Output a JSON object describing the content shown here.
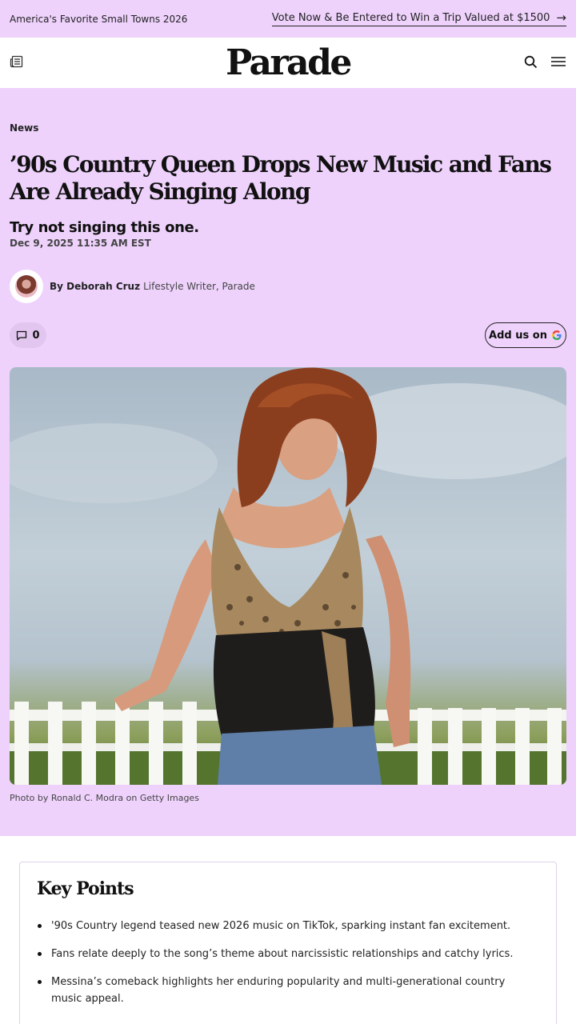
{
  "promo": {
    "left_text": "America's Favorite Small Towns 2026",
    "link_text": "Vote Now & Be Entered to Win a Trip Valued at $1500",
    "arrow": "→"
  },
  "nav": {
    "logo": "Parade",
    "icons": {
      "left": "newspaper-icon",
      "search": "search-icon",
      "menu": "hamburger-menu-icon"
    }
  },
  "article": {
    "category": "News",
    "headline": "’90s Country Queen Drops New Music and Fans Are Already Singing Along",
    "subheadline": "Try not singing this one.",
    "date": "Dec 9, 2025 11:35 AM EST",
    "author": {
      "byline": "By Deborah Cruz",
      "role": "Lifestyle Writer, Parade"
    },
    "comments_count": "0",
    "google_button_label": "Add us on",
    "google_glyph": "G",
    "photo_credit": "Photo by Ronald C. Modra on Getty Images"
  },
  "key_points": {
    "title": "Key Points",
    "items": [
      "'90s Country legend teased new 2026 music on TikTok, sparking instant fan excitement.",
      "Fans relate deeply to the song’s theme about narcissistic relationships and catchy lyrics.",
      "Messina’s comeback highlights her enduring popularity and multi-generational country music appeal."
    ]
  },
  "colors": {
    "accent_bg": "#eed2fc",
    "text": "#111111"
  }
}
